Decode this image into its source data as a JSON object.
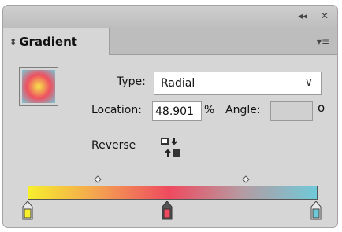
{
  "panel": {
    "collapse_glyph": "◂◂",
    "close_glyph": "✕",
    "tab_label": "Gradient",
    "tab_arrows_glyph": "⇕",
    "menu_glyph": "▾≡"
  },
  "fields": {
    "type_label": "Type:",
    "type_value": "Radial",
    "location_label": "Location:",
    "location_value": "48.901",
    "percent_sign": "%",
    "angle_label": "Angle:",
    "angle_value": "",
    "degree_symbol": "o",
    "reverse_label": "Reverse"
  },
  "gradient": {
    "type": "radial",
    "stops": [
      {
        "location": 0,
        "color": "#f7ee2d"
      },
      {
        "location": 48.901,
        "color": "#ef4a5f"
      },
      {
        "location": 100,
        "color": "#70c9d8"
      }
    ],
    "midpoints": [
      25,
      75
    ]
  },
  "icons": {
    "swatch": "gradient-preview-icon",
    "reverse": "reverse-gradient-icon",
    "chevron": "chevron-down-icon"
  }
}
